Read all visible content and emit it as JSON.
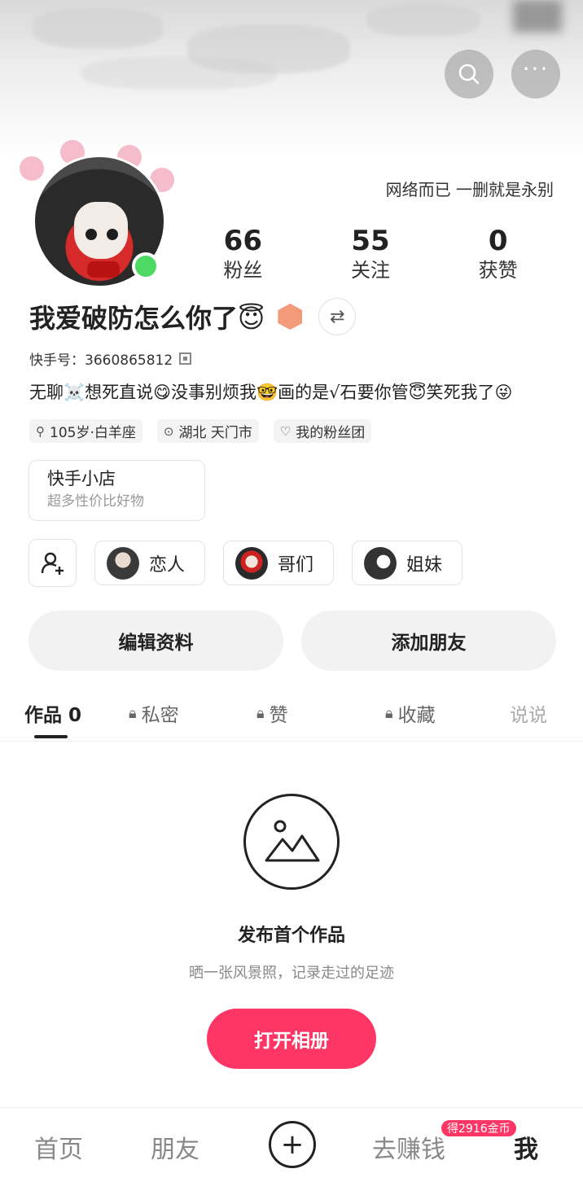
{
  "header": {
    "signature": "网络而已 一删就是永别"
  },
  "stats": [
    {
      "num": "66",
      "label": "粉丝"
    },
    {
      "num": "55",
      "label": "关注"
    },
    {
      "num": "0",
      "label": "获赞"
    }
  ],
  "profile": {
    "nickname": "我爱破防怎么你了😇",
    "user_id": "快手号：3660865812",
    "bio": "无聊☠️想死直说😋没事别烦我🤓画的是√石要你管😇笑死我了😜",
    "tags": [
      "105岁·白羊座",
      "湖北 天门市",
      "我的粉丝团"
    ]
  },
  "shop": {
    "title": "快手小店",
    "subtitle": "超多性价比好物"
  },
  "relations": [
    "恋人",
    "哥们",
    "姐妹"
  ],
  "actions": {
    "edit": "编辑资料",
    "add_friend": "添加朋友"
  },
  "tabs": [
    {
      "label": "作品 0"
    },
    {
      "label": "私密"
    },
    {
      "label": "赞"
    },
    {
      "label": "收藏"
    },
    {
      "label": "说说"
    }
  ],
  "empty": {
    "title": "发布首个作品",
    "desc": "晒一张风景照，记录走过的足迹",
    "button": "打开相册"
  },
  "nav": {
    "home": "首页",
    "friends": "朋友",
    "earn": "去赚钱",
    "me": "我",
    "coin_badge": "得2916金币"
  }
}
